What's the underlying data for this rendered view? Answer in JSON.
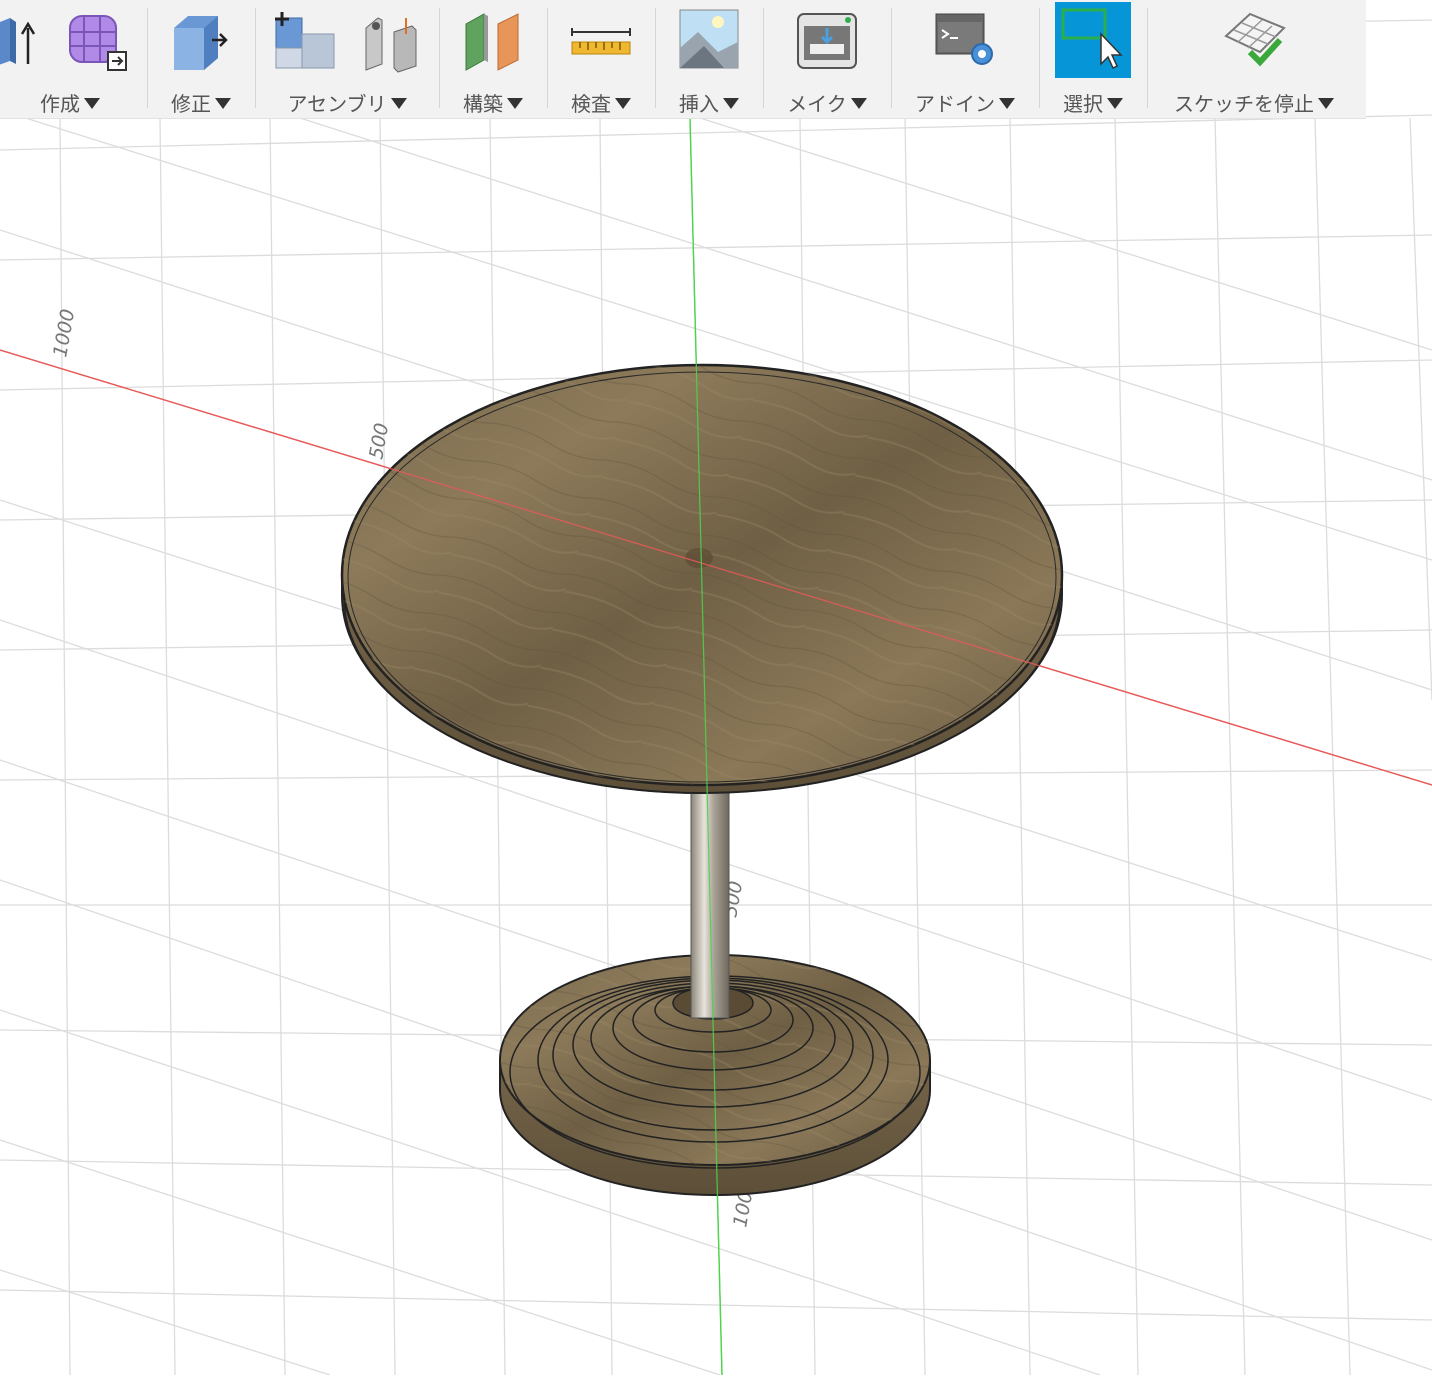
{
  "toolbar": {
    "groups": [
      {
        "label": "作成",
        "icons": [
          "extrude-icon",
          "form-icon"
        ]
      },
      {
        "label": "修正",
        "icons": [
          "press-pull-icon"
        ]
      },
      {
        "label": "アセンブリ",
        "icons": [
          "new-component-icon",
          "joint-icon"
        ]
      },
      {
        "label": "構築",
        "icons": [
          "offset-plane-icon"
        ]
      },
      {
        "label": "検査",
        "icons": [
          "measure-icon"
        ]
      },
      {
        "label": "挿入",
        "icons": [
          "insert-image-icon"
        ]
      },
      {
        "label": "メイク",
        "icons": [
          "3d-print-icon"
        ]
      },
      {
        "label": "アドイン",
        "icons": [
          "scripts-addins-icon"
        ]
      },
      {
        "label": "選択",
        "icons": [
          "select-window-icon"
        ]
      },
      {
        "label": "スケッチを停止",
        "icons": [
          "finish-sketch-icon"
        ]
      }
    ],
    "active_tool": "select-window-icon",
    "accent_color": "#0696d7"
  },
  "viewport": {
    "axis_labels": [
      "1000",
      "500",
      "500",
      "100"
    ],
    "x_axis_color": "#e85a5a",
    "y_axis_color": "#4cd44c",
    "grid_color": "#d9d9d9",
    "model": "round-pedestal-table",
    "material_color": "#7d6a4a"
  }
}
